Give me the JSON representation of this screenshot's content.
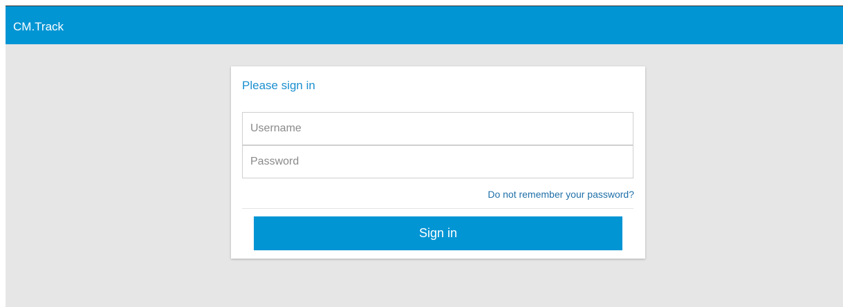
{
  "app": {
    "brand": "CM.Track"
  },
  "login": {
    "title": "Please sign in",
    "username_placeholder": "Username",
    "username_value": "",
    "password_placeholder": "Password",
    "password_value": "",
    "forgot_link": "Do not remember your password?",
    "submit_label": "Sign in"
  },
  "colors": {
    "header_bg": "#0295d4",
    "page_bg": "#e6e6e6",
    "title_text": "#1a8fcf",
    "link_text": "#1e6fa8",
    "button_bg": "#0295d4"
  }
}
